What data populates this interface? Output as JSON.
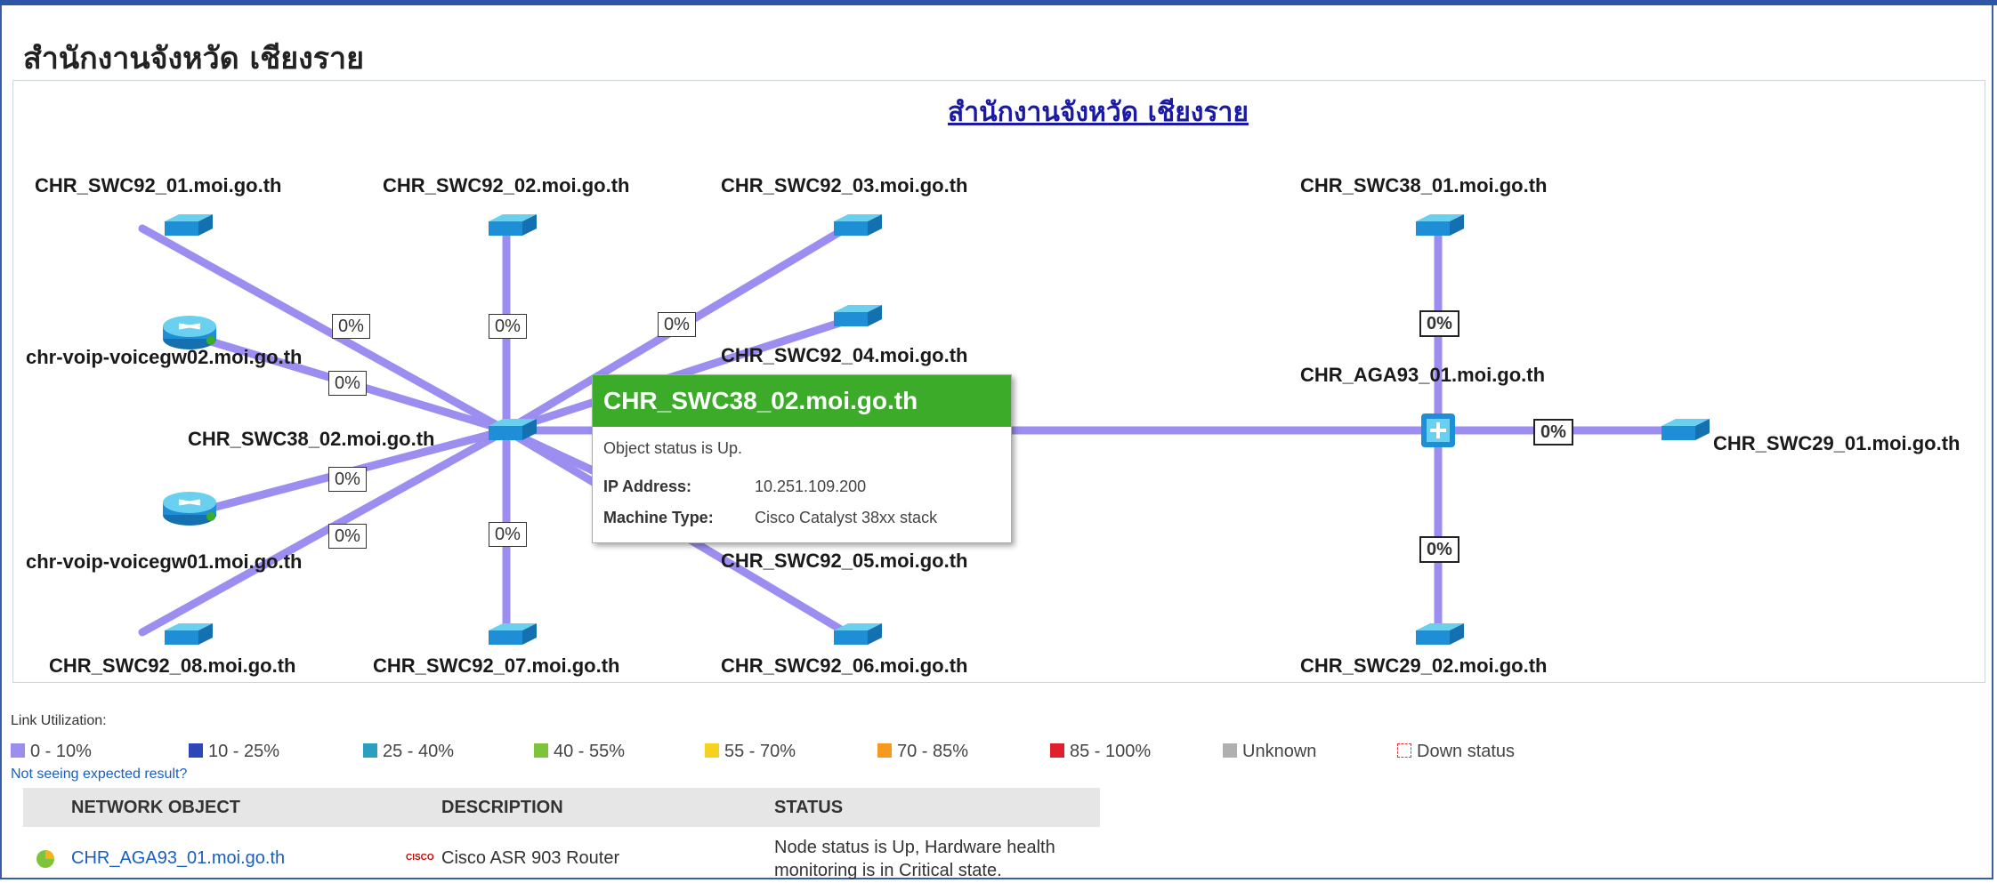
{
  "page": {
    "title": "สำนักงานจังหวัด เชียงราย"
  },
  "map": {
    "title": "สำนักงานจังหวัด เชียงราย",
    "labels": {
      "swc92_01": "CHR_SWC92_01.moi.go.th",
      "swc92_02": "CHR_SWC92_02.moi.go.th",
      "swc92_03": "CHR_SWC92_03.moi.go.th",
      "swc92_04": "CHR_SWC92_04.moi.go.th",
      "swc92_05": "CHR_SWC92_05.moi.go.th",
      "swc92_06": "CHR_SWC92_06.moi.go.th",
      "swc92_07": "CHR_SWC92_07.moi.go.th",
      "swc92_08": "CHR_SWC92_08.moi.go.th",
      "voicegw02": "chr-voip-voicegw02.moi.go.th",
      "voicegw01": "chr-voip-voicegw01.moi.go.th",
      "swc38_02": "CHR_SWC38_02.moi.go.th",
      "swc38_01": "CHR_SWC38_01.moi.go.th",
      "aga93_01": "CHR_AGA93_01.moi.go.th",
      "swc29_01": "CHR_SWC29_01.moi.go.th",
      "swc29_02": "CHR_SWC29_02.moi.go.th"
    },
    "link_util": {
      "l1": "0%",
      "l2": "0%",
      "l3": "0%",
      "l4": "0%",
      "l5": "0%",
      "l6": "0%",
      "l7": "0%",
      "l8": "0%",
      "l9": "0%",
      "l10": "0%",
      "l11": "0%",
      "l12": "0%"
    },
    "link_color": "#9b8ef0"
  },
  "tooltip": {
    "title": "CHR_SWC38_02.moi.go.th",
    "status": "Object status is Up.",
    "ip_label": "IP Address:",
    "ip_value": "10.251.109.200",
    "type_label": "Machine Type:",
    "type_value": "Cisco Catalyst 38xx stack",
    "header_color": "#3bab29"
  },
  "legend": {
    "title": "Link Utilization:",
    "items": [
      {
        "label": "0 - 10%",
        "color": "#9b8ef0"
      },
      {
        "label": "10 - 25%",
        "color": "#2c46b8"
      },
      {
        "label": "25 - 40%",
        "color": "#2aa0c0"
      },
      {
        "label": "40 - 55%",
        "color": "#7dc43c"
      },
      {
        "label": "55 - 70%",
        "color": "#f5d21e"
      },
      {
        "label": "70 - 85%",
        "color": "#f59a1e"
      },
      {
        "label": "85 - 100%",
        "color": "#e0202a"
      },
      {
        "label": "Unknown",
        "color": "#b0b0b0"
      },
      {
        "label": "Down status",
        "color": "#d33"
      }
    ],
    "hint": "Not seeing expected result?"
  },
  "table": {
    "headers": {
      "object": "NETWORK OBJECT",
      "description": "DESCRIPTION",
      "status": "STATUS"
    },
    "rows": [
      {
        "object": "CHR_AGA93_01.moi.go.th",
        "description": "Cisco ASR 903 Router",
        "vendor_logo": "CISCO",
        "status_line1": "Node status is Up, Hardware health",
        "status_line2": "monitoring is in Critical state."
      }
    ]
  }
}
